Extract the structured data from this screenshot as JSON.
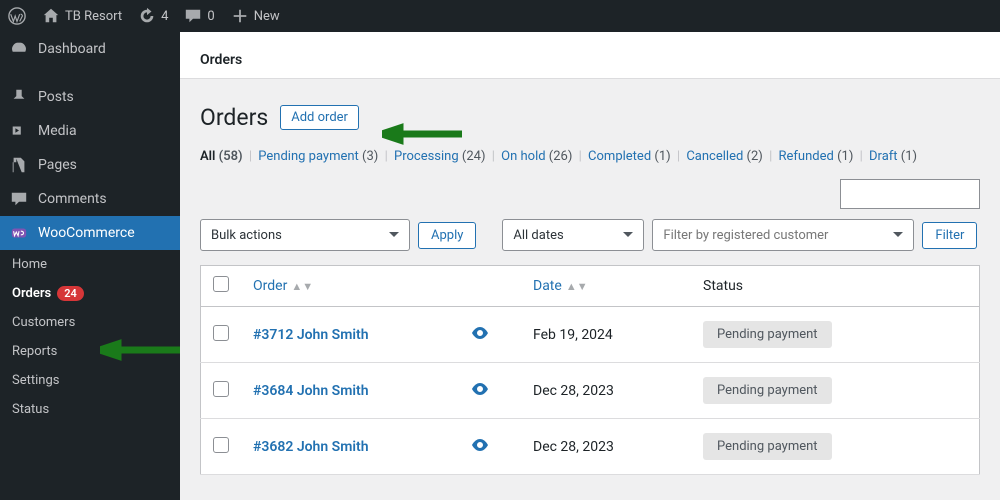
{
  "topbar": {
    "site": "TB Resort",
    "updates": "4",
    "comments": "0",
    "new": "New"
  },
  "sidebar": {
    "items": [
      "Dashboard",
      "Posts",
      "Media",
      "Pages",
      "Comments",
      "WooCommerce"
    ],
    "sub": [
      "Home",
      "Orders",
      "Customers",
      "Reports",
      "Settings",
      "Status"
    ],
    "orders_badge": "24"
  },
  "crumb": "Orders",
  "title": "Orders",
  "add_label": "Add order",
  "filters": {
    "all": "All",
    "all_cnt": "(58)",
    "pending": "Pending payment",
    "pending_cnt": "(3)",
    "processing": "Processing",
    "processing_cnt": "(24)",
    "hold": "On hold",
    "hold_cnt": "(26)",
    "completed": "Completed",
    "completed_cnt": "(1)",
    "cancelled": "Cancelled",
    "cancelled_cnt": "(2)",
    "refunded": "Refunded",
    "refunded_cnt": "(1)",
    "draft": "Draft",
    "draft_cnt": "(1)"
  },
  "controls": {
    "bulk": "Bulk actions",
    "apply": "Apply",
    "dates": "All dates",
    "customer": "Filter by registered customer",
    "filter": "Filter"
  },
  "headers": {
    "order": "Order",
    "date": "Date",
    "status": "Status"
  },
  "rows": [
    {
      "order": "#3712 John Smith",
      "date": "Feb 19, 2024",
      "status": "Pending payment"
    },
    {
      "order": "#3684 John Smith",
      "date": "Dec 28, 2023",
      "status": "Pending payment"
    },
    {
      "order": "#3682 John Smith",
      "date": "Dec 28, 2023",
      "status": "Pending payment"
    }
  ]
}
